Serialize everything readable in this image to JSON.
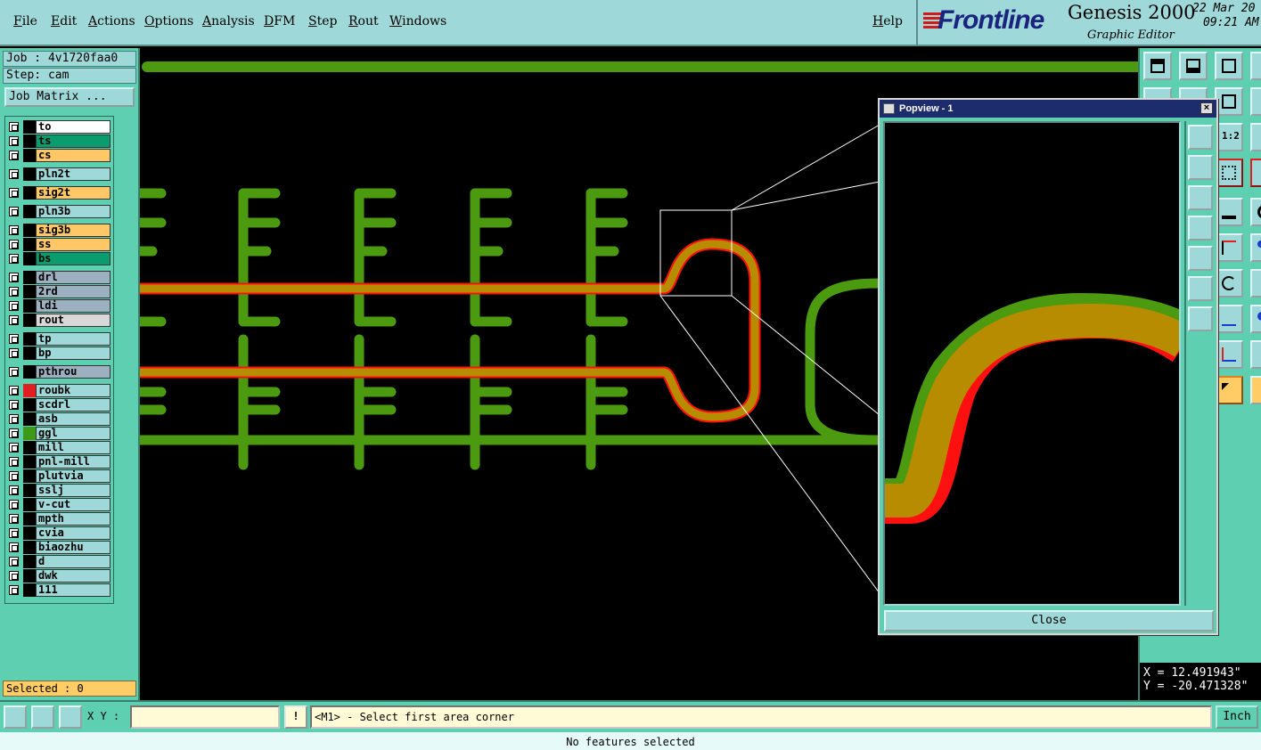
{
  "menu": [
    "File",
    "Edit",
    "Actions",
    "Options",
    "Analysis",
    "DFM",
    "Step",
    "Rout",
    "Windows"
  ],
  "help_label": "Help",
  "brand": {
    "logo": "Frontline",
    "product": "Genesis 2000",
    "subtitle": "Graphic Editor",
    "date": "22 Mar 20",
    "time": "09:21 AM"
  },
  "job": {
    "job_label": "Job : 4v1720faa0",
    "step_label": "Step: cam",
    "matrix_button": "Job Matrix ..."
  },
  "layers": [
    {
      "name": "to",
      "bg": "#ffffff",
      "sw": "#000000"
    },
    {
      "name": "ts",
      "bg": "#0a9c6c",
      "sw": "#000000"
    },
    {
      "name": "cs",
      "bg": "#ffc766",
      "sw": "#000000"
    },
    {
      "name": "pln2t",
      "bg": "#9fd8d8",
      "sw": "#000000"
    },
    {
      "name": "sig2t",
      "bg": "#ffc766",
      "sw": "#000000"
    },
    {
      "name": "pln3b",
      "bg": "#9fd8d8",
      "sw": "#000000"
    },
    {
      "name": "sig3b",
      "bg": "#ffc766",
      "sw": "#000000"
    },
    {
      "name": "ss",
      "bg": "#ffc766",
      "sw": "#000000"
    },
    {
      "name": "bs",
      "bg": "#0a9c6c",
      "sw": "#000000"
    },
    {
      "name": "drl",
      "bg": "#9cb0c0",
      "sw": "#000000"
    },
    {
      "name": "2rd",
      "bg": "#9cb0c0",
      "sw": "#000000"
    },
    {
      "name": "ldi",
      "bg": "#9cb0c0",
      "sw": "#000000"
    },
    {
      "name": "rout",
      "bg": "#d8d8d8",
      "sw": "#000000"
    },
    {
      "name": "tp",
      "bg": "#9fd8d8",
      "sw": "#000000"
    },
    {
      "name": "bp",
      "bg": "#9fd8d8",
      "sw": "#000000"
    },
    {
      "name": "pthrou",
      "bg": "#9cb0c0",
      "sw": "#000000"
    },
    {
      "name": "roubk",
      "bg": "#9fd8d8",
      "sw": "#e02020"
    },
    {
      "name": "scdrl",
      "bg": "#9fd8d8",
      "sw": "#000000"
    },
    {
      "name": "asb",
      "bg": "#9fd8d8",
      "sw": "#000000"
    },
    {
      "name": "ggl",
      "bg": "#9fd8d8",
      "sw": "#3c9a18"
    },
    {
      "name": "mill",
      "bg": "#9fd8d8",
      "sw": "#000000"
    },
    {
      "name": "pnl-mill",
      "bg": "#9fd8d8",
      "sw": "#000000"
    },
    {
      "name": "plutvia",
      "bg": "#9fd8d8",
      "sw": "#000000"
    },
    {
      "name": "sslj",
      "bg": "#9fd8d8",
      "sw": "#000000"
    },
    {
      "name": "v-cut",
      "bg": "#9fd8d8",
      "sw": "#000000"
    },
    {
      "name": "mpth",
      "bg": "#9fd8d8",
      "sw": "#000000"
    },
    {
      "name": "cvia",
      "bg": "#9fd8d8",
      "sw": "#000000"
    },
    {
      "name": "biaozhu",
      "bg": "#9fd8d8",
      "sw": "#000000"
    },
    {
      "name": "d",
      "bg": "#9fd8d8",
      "sw": "#000000"
    },
    {
      "name": "dwk",
      "bg": "#9fd8d8",
      "sw": "#000000"
    },
    {
      "name": "111",
      "bg": "#9fd8d8",
      "sw": "#000000"
    }
  ],
  "selected_label": "Selected : 0",
  "popview": {
    "title": "Popview - 1",
    "close_label": "Close"
  },
  "coords": {
    "x": "X = 12.491943\"",
    "y": "Y = -20.471328\""
  },
  "cmd": {
    "xy_label": "X Y :",
    "xy_value": "",
    "prompt": "<M1> - Select first area corner",
    "unit": "Inch"
  },
  "status": "No features selected",
  "colors": {
    "trace": "#4c9a10",
    "signal": "#b88c00",
    "rout": "#ff1010",
    "panel": "#5ecfb0",
    "button": "#9fd8d8"
  }
}
